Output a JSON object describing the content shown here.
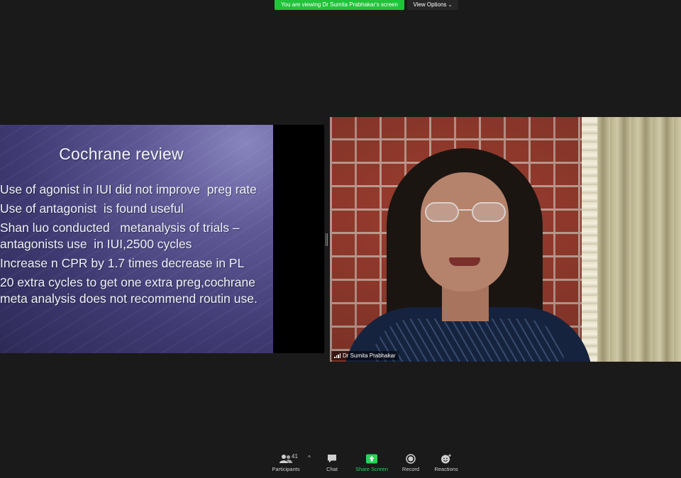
{
  "banner": {
    "viewing_text": "You are viewing Dr Sumita Prabhakar's screen",
    "view_options_label": "View Options",
    "view_options_caret": "⌄"
  },
  "slide": {
    "title": "Cochrane review",
    "bullets": [
      "Use of agonist in IUI did not improve  preg rate",
      "Use of antagonist  is found useful",
      "Shan luo conducted   metanalysis of trials –antagonists use  in IUI,2500 cycles",
      "Increase n CPR by 1.7 times decrease in PL",
      "20 extra cycles to get one extra preg,cochrane meta analysis does not recommend routin use."
    ]
  },
  "video": {
    "participant_name": "Dr Sumita Prabhakar"
  },
  "toolbar": {
    "participants_label": "Participants",
    "participants_count": "41",
    "participants_caret": "^",
    "chat_label": "Chat",
    "share_label": "Share Screen",
    "record_label": "Record",
    "reactions_label": "Reactions"
  },
  "colors": {
    "banner_green": "#22c33a",
    "share_green": "#2bd35a",
    "background": "#1a1a1a",
    "slide_purple": "#4a457f"
  },
  "icons": [
    "signal-bars-icon",
    "participants-icon",
    "chat-icon",
    "share-screen-icon",
    "record-icon",
    "reactions-icon",
    "chevron-down-icon",
    "chevron-up-icon"
  ]
}
